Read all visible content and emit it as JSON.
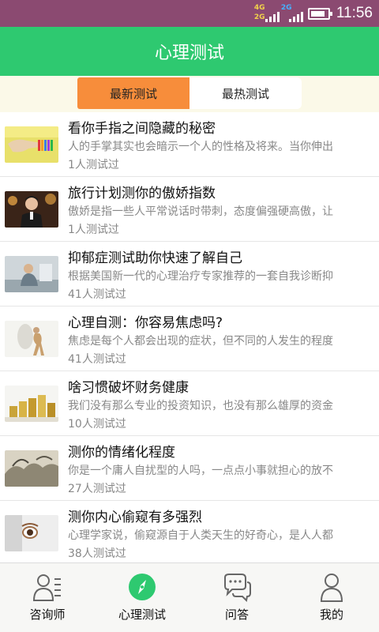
{
  "status_bar": {
    "network_top": "4G",
    "network_bottom": "2G",
    "network_second": "2G",
    "time": "11:56",
    "battery_level": 0.85
  },
  "header": {
    "title": "心理测试"
  },
  "tabs": [
    {
      "label": "最新测试",
      "active": true
    },
    {
      "label": "最热测试",
      "active": false
    }
  ],
  "tests": [
    {
      "title": "看你手指之间隐藏的秘密",
      "description": "人的手掌其实也会暗示一个人的性格及将来。当你伸出",
      "count": "1人测试过",
      "thumbnail": "hand-bracelets-photo"
    },
    {
      "title": "旅行计划测你的傲娇指数",
      "description": "傲娇是指一些人平常说话时带刺，态度偏强硬高傲，让",
      "count": "1人测试过",
      "thumbnail": "young-man-photo"
    },
    {
      "title": "抑郁症测试助你快速了解自己",
      "description": "根据美国新一代的心理治疗专家推荐的一套自我诊断抑",
      "count": "41人测试过",
      "thumbnail": "sad-person-photo"
    },
    {
      "title": "心理自测：你容易焦虑吗?",
      "description": "焦虑是每个人都会出现的症状，但不同的人发生的程度",
      "count": "41人测试过",
      "thumbnail": "anxious-figure-photo"
    },
    {
      "title": "啥习惯破坏财务健康",
      "description": "我们没有那么专业的投资知识，也没有那么雄厚的资金",
      "count": "10人测试过",
      "thumbnail": "coin-stacks-photo"
    },
    {
      "title": "测你的情绪化程度",
      "description": "你是一个庸人自扰型的人吗，一点点小事就担心的放不",
      "count": "27人测试过",
      "thumbnail": "ink-painting-photo"
    },
    {
      "title": "测你内心偷窥有多强烈",
      "description": "心理学家说，偷窥源自于人类天生的好奇心，是人人都",
      "count": "38人测试过",
      "thumbnail": "eye-peeking-photo"
    }
  ],
  "bottom_nav": [
    {
      "label": "咨询师",
      "icon": "counselor-icon",
      "active": false
    },
    {
      "label": "心理测试",
      "icon": "compass-icon",
      "active": true
    },
    {
      "label": "问答",
      "icon": "chat-bubbles-icon",
      "active": false
    },
    {
      "label": "我的",
      "icon": "person-icon",
      "active": false
    }
  ],
  "colors": {
    "status_bar": "#8b4a71",
    "header": "#2ec970",
    "active_tab": "#f78d3b",
    "accent": "#2ec970"
  }
}
